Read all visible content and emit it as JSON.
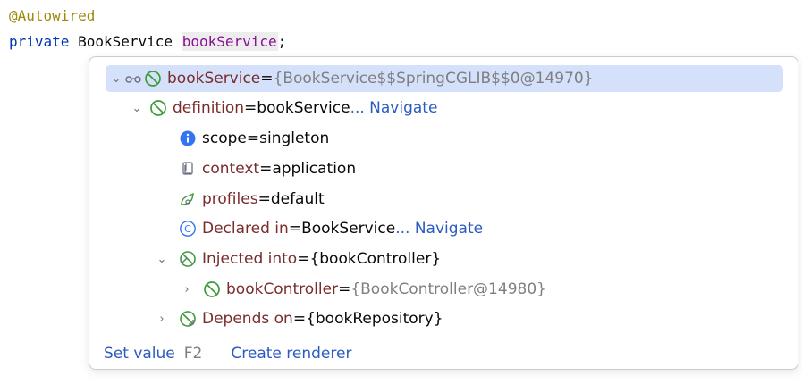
{
  "code": {
    "annotation": "@Autowired",
    "keyword": "private",
    "type": "BookService",
    "field": "bookService",
    "semicolon": ";"
  },
  "tree": {
    "root": {
      "name": "bookService",
      "eq": " = ",
      "value": "{BookService$$SpringCGLIB$$0@14970}"
    },
    "definition": {
      "name": "definition",
      "eq": " = ",
      "value": "bookService",
      "link": " ... Navigate"
    },
    "scope": {
      "name": "scope",
      "eq": " = ",
      "value": "singleton"
    },
    "context": {
      "name": "context",
      "eq": " = ",
      "value": "application"
    },
    "profiles": {
      "name": "profiles",
      "eq": " = ",
      "value": "default"
    },
    "declared": {
      "name": "Declared in",
      "eq": " = ",
      "value": "BookService",
      "link": " ... Navigate"
    },
    "injected": {
      "name": "Injected into",
      "eq": " = ",
      "value": "{bookController}"
    },
    "controller": {
      "name": "bookController",
      "eq": " = ",
      "value": "{BookController@14980}"
    },
    "depends": {
      "name": "Depends on",
      "eq": " = ",
      "value": "{bookRepository}"
    }
  },
  "footer": {
    "set_value": "Set value",
    "set_value_key": "F2",
    "create_renderer": "Create renderer"
  },
  "icons": {
    "watch": "glasses-icon",
    "bean": "spring-bean-icon",
    "info": "info-icon",
    "context": "document-icon",
    "profiles": "profiles-icon",
    "class": "class-icon",
    "injected": "injection-icon",
    "depends": "dependency-icon"
  },
  "colors": {
    "accent": "#2d5bbf",
    "selection": "#d5e1fb",
    "bean_green": "#3d9b3a",
    "field_purple": "#871094"
  }
}
